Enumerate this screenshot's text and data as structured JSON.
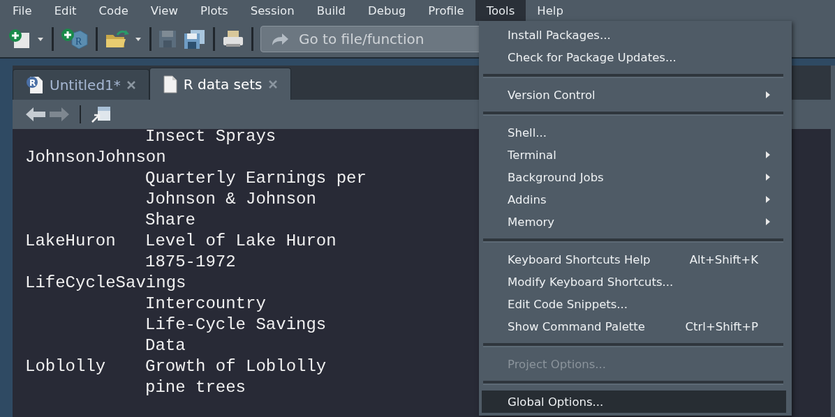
{
  "menubar": [
    {
      "label": "File",
      "selected": false
    },
    {
      "label": "Edit",
      "selected": false
    },
    {
      "label": "Code",
      "selected": false
    },
    {
      "label": "View",
      "selected": false
    },
    {
      "label": "Plots",
      "selected": false
    },
    {
      "label": "Session",
      "selected": false
    },
    {
      "label": "Build",
      "selected": false
    },
    {
      "label": "Debug",
      "selected": false
    },
    {
      "label": "Profile",
      "selected": false
    },
    {
      "label": "Tools",
      "selected": true
    },
    {
      "label": "Help",
      "selected": false
    }
  ],
  "toolbar": {
    "search": {
      "placeholder": "Go to file/function"
    },
    "save_disabled": true,
    "project_icon_letter": "R"
  },
  "tabs": [
    {
      "label": "Untitled1*",
      "kind": "rscript",
      "icon_letter": "R",
      "selected": false
    },
    {
      "label": "R data sets",
      "kind": "document",
      "selected": true
    }
  ],
  "nav": {
    "back_disabled": false,
    "forward_disabled": true
  },
  "datasets": [
    {
      "lines": [
        "Insect Sprays"
      ]
    },
    {
      "name": "JohnsonJohnson",
      "lines": [
        "Quarterly Earnings per",
        "Johnson & Johnson",
        "Share"
      ]
    },
    {
      "name": "LakeHuron",
      "lines": [
        "Level of Lake Huron",
        "1875-1972"
      ]
    },
    {
      "name": "LifeCycleSavings",
      "lines": [
        "Intercountry",
        "Life-Cycle Savings",
        "Data"
      ]
    },
    {
      "name": "Loblolly",
      "lines": [
        "Growth of Loblolly",
        "pine trees"
      ]
    }
  ],
  "tools_menu": [
    [
      {
        "label": "Install Packages...",
        "disabled": false,
        "selected": false
      },
      {
        "label": "Check for Package Updates...",
        "disabled": false,
        "selected": false
      }
    ],
    [
      {
        "label": "Version Control",
        "submenu": true,
        "disabled": false,
        "selected": false
      }
    ],
    [
      {
        "label": "Shell...",
        "disabled": false,
        "selected": false
      },
      {
        "label": "Terminal",
        "submenu": true,
        "disabled": false,
        "selected": false
      },
      {
        "label": "Background Jobs",
        "submenu": true,
        "disabled": false,
        "selected": false
      },
      {
        "label": "Addins",
        "submenu": true,
        "disabled": false,
        "selected": false
      },
      {
        "label": "Memory",
        "submenu": true,
        "disabled": false,
        "selected": false
      }
    ],
    [
      {
        "label": "Keyboard Shortcuts Help",
        "shortcut": "Alt+Shift+K",
        "disabled": false,
        "selected": false
      },
      {
        "label": "Modify Keyboard Shortcuts...",
        "disabled": false,
        "selected": false
      },
      {
        "label": "Edit Code Snippets...",
        "disabled": false,
        "selected": false
      },
      {
        "label": "Show Command Palette",
        "shortcut": "Ctrl+Shift+P",
        "disabled": false,
        "selected": false
      }
    ],
    [
      {
        "label": "Project Options...",
        "disabled": true,
        "selected": false
      }
    ],
    [
      {
        "label": "Global Options...",
        "disabled": false,
        "selected": true
      }
    ]
  ]
}
